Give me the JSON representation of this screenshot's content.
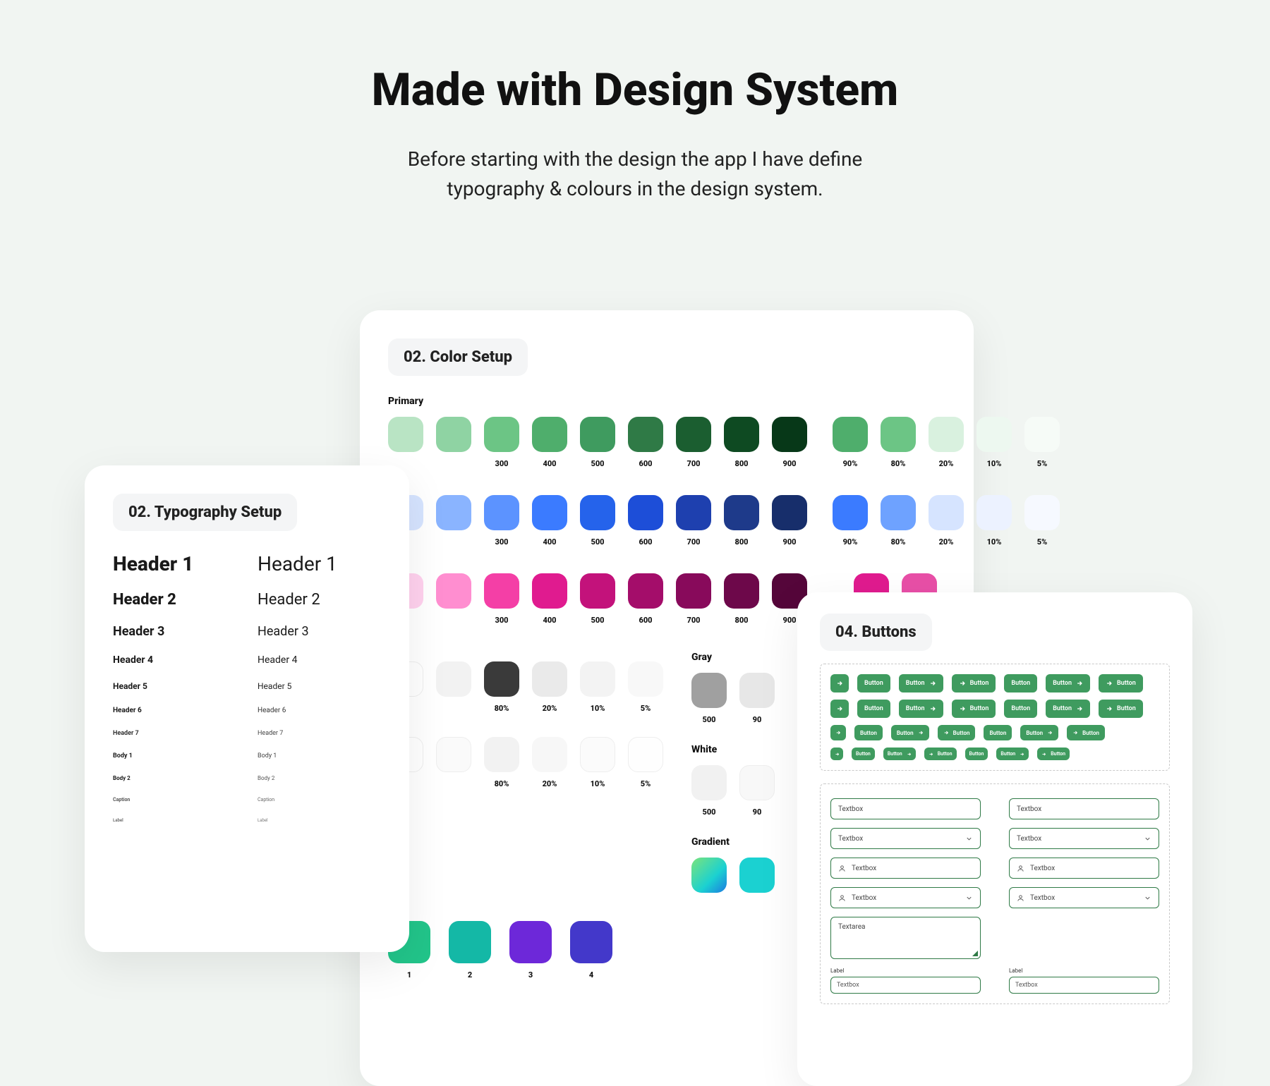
{
  "page": {
    "title": "Made with Design System",
    "subtitle_line1": "Before starting with the design the app I have define",
    "subtitle_line2": "typography & colours in the design system."
  },
  "typography": {
    "badge": "02. Typography Setup",
    "rows": [
      {
        "bold": "Header 1",
        "regular": "Header 1"
      },
      {
        "bold": "Header 2",
        "regular": "Header 2"
      },
      {
        "bold": "Header 3",
        "regular": "Header 3"
      },
      {
        "bold": "Header 4",
        "regular": "Header 4"
      },
      {
        "bold": "Header 5",
        "regular": "Header 5"
      },
      {
        "bold": "Header 6",
        "regular": "Header 6"
      },
      {
        "bold": "Header 7",
        "regular": "Header 7"
      },
      {
        "bold": "Body 1",
        "regular": "Body 1"
      },
      {
        "bold": "Body 2",
        "regular": "Body 2"
      },
      {
        "bold": "Caption",
        "regular": "Caption"
      },
      {
        "bold": "Label",
        "regular": "Label"
      }
    ]
  },
  "colors": {
    "badge": "02. Color Setup",
    "primary_label": "Primary",
    "gray_label": "Gray",
    "white_label": "White",
    "gradient_label": "Gradient",
    "scale_labels": [
      "300",
      "400",
      "500",
      "600",
      "700",
      "800",
      "900"
    ],
    "opacity_labels": [
      "90%",
      "80%",
      "20%",
      "10%",
      "5%"
    ],
    "dual_opacity_labels": [
      "80%",
      "20%",
      "10%",
      "5%"
    ],
    "gradient_nums": [
      "1",
      "2",
      "3",
      "4"
    ],
    "gray_scale": [
      "500",
      "90"
    ],
    "white_scale": [
      "500",
      "90"
    ],
    "green": {
      "scale": [
        "#b9e4c4",
        "#8fd3a3",
        "#6cc585",
        "#4fae6c",
        "#3f9b5f",
        "#2f7a46",
        "#1b5e30",
        "#0e4a22",
        "#073818"
      ],
      "opacity": [
        "#4fae6c",
        "#6cc585",
        "#c9e9d2",
        "#e6f5ea",
        "#f2faf4"
      ]
    },
    "blue": {
      "scale": [
        "#8ab4ff",
        "#5c93ff",
        "#3b7bff",
        "#2563eb",
        "#1d4ed8",
        "#1e40af",
        "#1e3a8a",
        "#172e6b",
        "#0f1f4d"
      ],
      "opacity": [
        "#3b7bff",
        "#6ea2ff",
        "#d6e4ff",
        "#ecf2ff",
        "#f6f9ff"
      ],
      "leading": [
        "#d6e4ff",
        "#8ab4ff"
      ]
    },
    "magenta": {
      "scale": [
        "#ff6fc4",
        "#f43fa6",
        "#e01b8f",
        "#c3127b",
        "#a40d6a",
        "#880a5b",
        "#6d084a",
        "#55063a",
        "#3d042b"
      ],
      "opacity": [
        "#e01b8f",
        "#e84fa7"
      ]
    },
    "grays": {
      "dual": [
        "#3a3a3a",
        "#eaeaea",
        "#f3f3f3",
        "#f8f8f8"
      ],
      "gray500": "#a0a0a0",
      "gray90": "#e7e7e7",
      "white500": "#f1f1f1",
      "white90": "#f8f8f8"
    },
    "lower_dual": [
      "#f2f2f2",
      "#f7f7f7",
      "#fbfbfb",
      "#fefefe"
    ],
    "gradients": [
      "#22c58a",
      "#14b8a6",
      "#6d28d9",
      "#4338ca"
    ],
    "gradient_big": "linear-gradient(135deg,#7be37b 0%,#1bd1d1 60%,#1c7ae0 100%)"
  },
  "buttons": {
    "badge": "04. Buttons",
    "btn_label": "Button",
    "textbox_label": "Textbox",
    "textarea_label": "Textarea",
    "label_label": "Label"
  }
}
